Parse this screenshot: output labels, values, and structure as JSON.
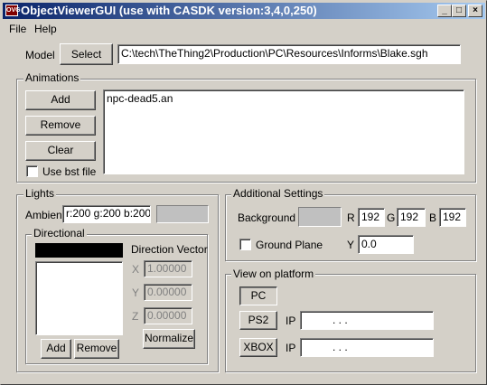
{
  "window": {
    "title": "ObjectViewerGUI  (use with CASDK version:3,4,0,250)",
    "app_icon_text": "OVG",
    "minimize": "_",
    "maximize": "□",
    "close": "×"
  },
  "menu": {
    "items": [
      "File",
      "Help"
    ]
  },
  "model": {
    "label": "Model",
    "select_label": "Select",
    "path": "C:\\tech\\TheThing2\\Production\\PC\\Resources\\Informs\\Blake.sgh"
  },
  "animations": {
    "group_label": "Animations",
    "add_label": "Add",
    "remove_label": "Remove",
    "clear_label": "Clear",
    "use_bst_label": "Use bst file",
    "list_items": [
      "npc-dead5.an"
    ]
  },
  "lights": {
    "group_label": "Lights",
    "ambient_label": "Ambient",
    "ambient_value": "r:200 g:200 b:200",
    "ambient_swatch_color": "#c8c8c8",
    "directional": {
      "group_label": "Directional",
      "header_color": "#000000",
      "direction_vector_label": "Direction Vector",
      "x_label": "X",
      "x_value": "1.00000",
      "y_label": "Y",
      "y_value": "0.00000",
      "z_label": "Z",
      "z_value": "0.00000",
      "add_label": "Add",
      "remove_label": "Remove",
      "normalize_label": "Normalize"
    }
  },
  "additional": {
    "group_label": "Additional Settings",
    "background_label": "Background",
    "background_swatch_color": "#c0c0c0",
    "r_label": "R",
    "r_value": "192",
    "g_label": "G",
    "g_value": "192",
    "b_label": "B",
    "b_value": "192",
    "ground_plane_label": "Ground Plane",
    "y_label": "Y",
    "y_value": "0.0"
  },
  "platform": {
    "group_label": "View on platform",
    "pc_label": "PC",
    "ps2_label": "PS2",
    "ps2_ip_label": "IP",
    "ps2_ip_value": ".       .       .",
    "xbox_label": "XBOX",
    "xbox_ip_label": "IP",
    "xbox_ip_value": ".       .       ."
  }
}
